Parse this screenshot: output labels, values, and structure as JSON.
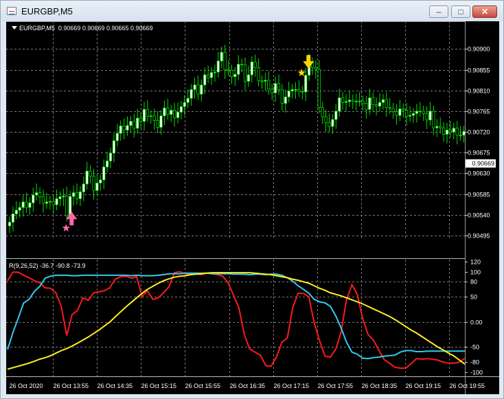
{
  "window": {
    "title": "EURGBP,M5"
  },
  "titlebar_buttons": {
    "minimize": "–",
    "maximize": "□",
    "close": "✕"
  },
  "chart_header": {
    "symbol": "EURGBP,M5",
    "ohlc": "0.90669 0.90669 0.90665 0.90669"
  },
  "current_price": "0.90669",
  "indicator": {
    "label": "R(9,26,52) -36.7 -90.8 -73.9",
    "params": [
      9,
      26,
      52
    ],
    "values": [
      -36.7,
      -90.8,
      -73.9
    ]
  },
  "colors": {
    "bull_fill": "#ffffff",
    "bear_fill": "#000000",
    "candle_outline": "#00e000",
    "line_red": "#ff1a1a",
    "line_cyan": "#33ccee",
    "line_yellow": "#ffee22",
    "buy_arrow": "#ff66aa",
    "sell_arrow": "#ffd400",
    "grid": "#7a7a7a"
  },
  "chart_data": [
    {
      "type": "candlestick",
      "title": "EURGBP,M5",
      "ylim": [
        0.90495,
        0.9092
      ],
      "y_ticks": [
        "0.90900",
        "0.90855",
        "0.90810",
        "0.90765",
        "0.90720",
        "0.90675",
        "0.90630",
        "0.90585",
        "0.90540",
        "0.90495"
      ],
      "x_ticks": [
        "26 Oct 2020",
        "26 Oct 13:55",
        "26 Oct 14:35",
        "26 Oct 15:15",
        "26 Oct 15:55",
        "26 Oct 16:35",
        "26 Oct 17:15",
        "26 Oct 17:55",
        "26 Oct 18:35",
        "26 Oct 19:15",
        "26 Oct 19:55"
      ],
      "closes": [
        0.90524,
        0.90542,
        0.9055,
        0.90556,
        0.90568,
        0.90556,
        0.90566,
        0.90583,
        0.90588,
        0.90579,
        0.90565,
        0.90568,
        0.90569,
        0.90562,
        0.90575,
        0.90579,
        0.90581,
        0.90538,
        0.9058,
        0.90588,
        0.90575,
        0.9059,
        0.90607,
        0.90635,
        0.90624,
        0.90593,
        0.90609,
        0.90616,
        0.90644,
        0.90657,
        0.90674,
        0.90701,
        0.90717,
        0.90733,
        0.90724,
        0.90734,
        0.90743,
        0.90728,
        0.9075,
        0.90743,
        0.90769,
        0.90754,
        0.90755,
        0.90745,
        0.9073,
        0.90755,
        0.90772,
        0.90758,
        0.90767,
        0.90751,
        0.90763,
        0.90775,
        0.90784,
        0.90793,
        0.90812,
        0.90822,
        0.90802,
        0.90822,
        0.90844,
        0.90838,
        0.90849,
        0.9085,
        0.90874,
        0.90893,
        0.90855,
        0.90854,
        0.9084,
        0.90845,
        0.90867,
        0.90866,
        0.9083,
        0.90844,
        0.90872,
        0.9086,
        0.90831,
        0.9083,
        0.90832,
        0.90813,
        0.90805,
        0.90825,
        0.90812,
        0.90782,
        0.90796,
        0.90809,
        0.90812,
        0.90812,
        0.90808,
        0.90807,
        0.90843,
        0.9087,
        0.9086,
        0.90856,
        0.90773,
        0.90753,
        0.9074,
        0.90732,
        0.90747,
        0.90765,
        0.90794,
        0.90784,
        0.90786,
        0.90789,
        0.90786,
        0.90787,
        0.90787,
        0.90782,
        0.90769,
        0.90794,
        0.90779,
        0.90776,
        0.90784,
        0.9079,
        0.90773,
        0.90771,
        0.90764,
        0.90756,
        0.9077,
        0.90767,
        0.90754,
        0.90756,
        0.9076,
        0.90765,
        0.90765,
        0.9076,
        0.90746,
        0.90765,
        0.90729,
        0.90732,
        0.90729,
        0.90715,
        0.90724,
        0.9072,
        0.90728,
        0.90713,
        0.90713,
        0.90721
      ],
      "markers": {
        "buy_arrow_value": 0.90535,
        "sell_arrow_value": 0.90896
      }
    },
    {
      "type": "line",
      "title": "R(9,26,52) -36.7 -90.8 -73.9",
      "ylim": [
        -100,
        120
      ],
      "y_ticks": [
        "120",
        "100",
        "80",
        "50",
        "0.00",
        "-50",
        "-80",
        "-100"
      ],
      "series": [
        {
          "name": "R(9)",
          "color": "#ff1a1a",
          "values": [
            82,
            99,
            99,
            93,
            88,
            82,
            78,
            68,
            67,
            58,
            30,
            -27,
            15,
            23,
            48,
            43,
            58,
            60,
            62,
            68,
            85,
            90,
            91,
            87,
            90,
            51,
            62,
            45,
            48,
            58,
            70,
            98,
            100,
            96,
            95,
            96,
            94,
            97,
            96,
            94,
            91,
            78,
            53,
            28,
            -25,
            -54,
            -60,
            -66,
            -87,
            -88,
            -69,
            -40,
            -32,
            28,
            57,
            57,
            50,
            -2,
            -37,
            -68,
            -70,
            -54,
            -20,
            44,
            74,
            55,
            7,
            -25,
            -36,
            -56,
            -75,
            -82,
            -90,
            -92,
            -92,
            -83,
            -73,
            -74,
            -73,
            -74,
            -76,
            -80,
            -82,
            -82,
            -80,
            -72
          ]
        },
        {
          "name": "R(26)",
          "color": "#33ccee",
          "values": [
            -55,
            -21,
            8,
            38,
            45,
            61,
            71,
            87,
            91,
            93,
            93,
            93,
            92,
            92,
            93,
            93,
            93,
            93,
            93,
            93,
            93,
            93,
            93,
            92,
            93,
            92,
            92,
            92,
            93,
            94,
            96,
            96,
            96,
            97,
            97,
            97,
            97,
            97,
            96,
            96,
            96,
            96,
            95,
            95,
            95,
            94,
            95,
            95,
            94,
            95,
            95,
            93,
            88,
            81,
            72,
            65,
            57,
            45,
            40,
            38,
            31,
            12,
            -12,
            -40,
            -60,
            -64,
            -72,
            -73,
            -71,
            -70,
            -68,
            -67,
            -66,
            -60,
            -57,
            -57,
            -59,
            -59,
            -58,
            -58,
            -58,
            -58,
            -58,
            -58,
            -58,
            -58
          ]
        },
        {
          "name": "R(52)",
          "color": "#ffee22",
          "values": [
            -94,
            -91,
            -88,
            -85,
            -82,
            -78,
            -74,
            -71,
            -67,
            -62,
            -57,
            -53,
            -48,
            -42,
            -36,
            -30,
            -23,
            -16,
            -8,
            0,
            10,
            20,
            30,
            39,
            48,
            57,
            65,
            71,
            77,
            82,
            86,
            89,
            91,
            92,
            94,
            95,
            96,
            97,
            98,
            98,
            98,
            98,
            98,
            98,
            98,
            98,
            97,
            96,
            95,
            94,
            92,
            90,
            88,
            85,
            83,
            80,
            77,
            72,
            67,
            63,
            58,
            55,
            52,
            48,
            44,
            40,
            36,
            31,
            26,
            21,
            16,
            11,
            5,
            -2,
            -9,
            -16,
            -22,
            -29,
            -36,
            -43,
            -50,
            -56,
            -62,
            -68,
            -76,
            -84
          ]
        }
      ]
    }
  ]
}
